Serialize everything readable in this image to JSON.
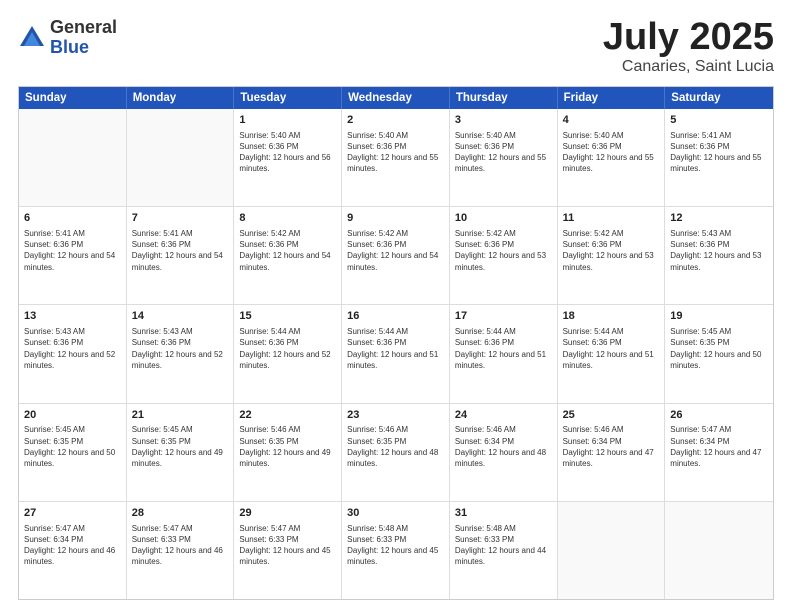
{
  "logo": {
    "general": "General",
    "blue": "Blue"
  },
  "title": "July 2025",
  "location": "Canaries, Saint Lucia",
  "header_days": [
    "Sunday",
    "Monday",
    "Tuesday",
    "Wednesday",
    "Thursday",
    "Friday",
    "Saturday"
  ],
  "weeks": [
    [
      {
        "day": "",
        "sunrise": "",
        "sunset": "",
        "daylight": ""
      },
      {
        "day": "",
        "sunrise": "",
        "sunset": "",
        "daylight": ""
      },
      {
        "day": "1",
        "sunrise": "Sunrise: 5:40 AM",
        "sunset": "Sunset: 6:36 PM",
        "daylight": "Daylight: 12 hours and 56 minutes."
      },
      {
        "day": "2",
        "sunrise": "Sunrise: 5:40 AM",
        "sunset": "Sunset: 6:36 PM",
        "daylight": "Daylight: 12 hours and 55 minutes."
      },
      {
        "day": "3",
        "sunrise": "Sunrise: 5:40 AM",
        "sunset": "Sunset: 6:36 PM",
        "daylight": "Daylight: 12 hours and 55 minutes."
      },
      {
        "day": "4",
        "sunrise": "Sunrise: 5:40 AM",
        "sunset": "Sunset: 6:36 PM",
        "daylight": "Daylight: 12 hours and 55 minutes."
      },
      {
        "day": "5",
        "sunrise": "Sunrise: 5:41 AM",
        "sunset": "Sunset: 6:36 PM",
        "daylight": "Daylight: 12 hours and 55 minutes."
      }
    ],
    [
      {
        "day": "6",
        "sunrise": "Sunrise: 5:41 AM",
        "sunset": "Sunset: 6:36 PM",
        "daylight": "Daylight: 12 hours and 54 minutes."
      },
      {
        "day": "7",
        "sunrise": "Sunrise: 5:41 AM",
        "sunset": "Sunset: 6:36 PM",
        "daylight": "Daylight: 12 hours and 54 minutes."
      },
      {
        "day": "8",
        "sunrise": "Sunrise: 5:42 AM",
        "sunset": "Sunset: 6:36 PM",
        "daylight": "Daylight: 12 hours and 54 minutes."
      },
      {
        "day": "9",
        "sunrise": "Sunrise: 5:42 AM",
        "sunset": "Sunset: 6:36 PM",
        "daylight": "Daylight: 12 hours and 54 minutes."
      },
      {
        "day": "10",
        "sunrise": "Sunrise: 5:42 AM",
        "sunset": "Sunset: 6:36 PM",
        "daylight": "Daylight: 12 hours and 53 minutes."
      },
      {
        "day": "11",
        "sunrise": "Sunrise: 5:42 AM",
        "sunset": "Sunset: 6:36 PM",
        "daylight": "Daylight: 12 hours and 53 minutes."
      },
      {
        "day": "12",
        "sunrise": "Sunrise: 5:43 AM",
        "sunset": "Sunset: 6:36 PM",
        "daylight": "Daylight: 12 hours and 53 minutes."
      }
    ],
    [
      {
        "day": "13",
        "sunrise": "Sunrise: 5:43 AM",
        "sunset": "Sunset: 6:36 PM",
        "daylight": "Daylight: 12 hours and 52 minutes."
      },
      {
        "day": "14",
        "sunrise": "Sunrise: 5:43 AM",
        "sunset": "Sunset: 6:36 PM",
        "daylight": "Daylight: 12 hours and 52 minutes."
      },
      {
        "day": "15",
        "sunrise": "Sunrise: 5:44 AM",
        "sunset": "Sunset: 6:36 PM",
        "daylight": "Daylight: 12 hours and 52 minutes."
      },
      {
        "day": "16",
        "sunrise": "Sunrise: 5:44 AM",
        "sunset": "Sunset: 6:36 PM",
        "daylight": "Daylight: 12 hours and 51 minutes."
      },
      {
        "day": "17",
        "sunrise": "Sunrise: 5:44 AM",
        "sunset": "Sunset: 6:36 PM",
        "daylight": "Daylight: 12 hours and 51 minutes."
      },
      {
        "day": "18",
        "sunrise": "Sunrise: 5:44 AM",
        "sunset": "Sunset: 6:36 PM",
        "daylight": "Daylight: 12 hours and 51 minutes."
      },
      {
        "day": "19",
        "sunrise": "Sunrise: 5:45 AM",
        "sunset": "Sunset: 6:35 PM",
        "daylight": "Daylight: 12 hours and 50 minutes."
      }
    ],
    [
      {
        "day": "20",
        "sunrise": "Sunrise: 5:45 AM",
        "sunset": "Sunset: 6:35 PM",
        "daylight": "Daylight: 12 hours and 50 minutes."
      },
      {
        "day": "21",
        "sunrise": "Sunrise: 5:45 AM",
        "sunset": "Sunset: 6:35 PM",
        "daylight": "Daylight: 12 hours and 49 minutes."
      },
      {
        "day": "22",
        "sunrise": "Sunrise: 5:46 AM",
        "sunset": "Sunset: 6:35 PM",
        "daylight": "Daylight: 12 hours and 49 minutes."
      },
      {
        "day": "23",
        "sunrise": "Sunrise: 5:46 AM",
        "sunset": "Sunset: 6:35 PM",
        "daylight": "Daylight: 12 hours and 48 minutes."
      },
      {
        "day": "24",
        "sunrise": "Sunrise: 5:46 AM",
        "sunset": "Sunset: 6:34 PM",
        "daylight": "Daylight: 12 hours and 48 minutes."
      },
      {
        "day": "25",
        "sunrise": "Sunrise: 5:46 AM",
        "sunset": "Sunset: 6:34 PM",
        "daylight": "Daylight: 12 hours and 47 minutes."
      },
      {
        "day": "26",
        "sunrise": "Sunrise: 5:47 AM",
        "sunset": "Sunset: 6:34 PM",
        "daylight": "Daylight: 12 hours and 47 minutes."
      }
    ],
    [
      {
        "day": "27",
        "sunrise": "Sunrise: 5:47 AM",
        "sunset": "Sunset: 6:34 PM",
        "daylight": "Daylight: 12 hours and 46 minutes."
      },
      {
        "day": "28",
        "sunrise": "Sunrise: 5:47 AM",
        "sunset": "Sunset: 6:33 PM",
        "daylight": "Daylight: 12 hours and 46 minutes."
      },
      {
        "day": "29",
        "sunrise": "Sunrise: 5:47 AM",
        "sunset": "Sunset: 6:33 PM",
        "daylight": "Daylight: 12 hours and 45 minutes."
      },
      {
        "day": "30",
        "sunrise": "Sunrise: 5:48 AM",
        "sunset": "Sunset: 6:33 PM",
        "daylight": "Daylight: 12 hours and 45 minutes."
      },
      {
        "day": "31",
        "sunrise": "Sunrise: 5:48 AM",
        "sunset": "Sunset: 6:33 PM",
        "daylight": "Daylight: 12 hours and 44 minutes."
      },
      {
        "day": "",
        "sunrise": "",
        "sunset": "",
        "daylight": ""
      },
      {
        "day": "",
        "sunrise": "",
        "sunset": "",
        "daylight": ""
      }
    ]
  ]
}
